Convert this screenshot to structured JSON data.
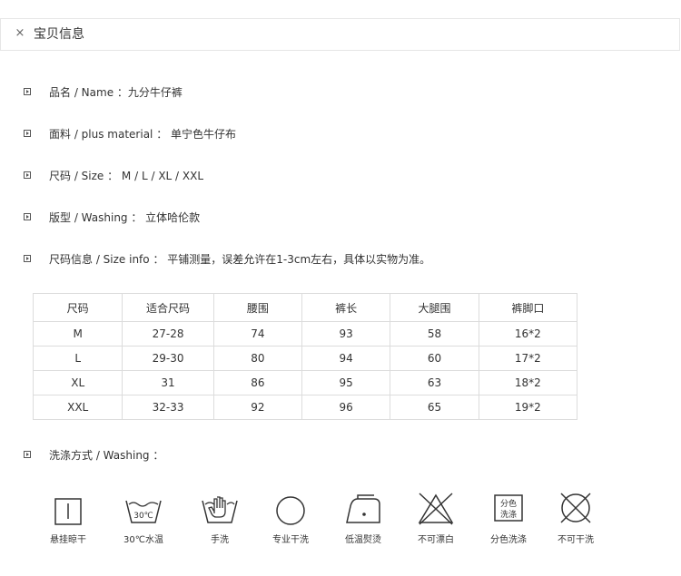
{
  "header": {
    "close_glyph": "×",
    "title": "宝贝信息"
  },
  "attributes": [
    {
      "label": "品名 / Name ：九分牛仔裤"
    },
    {
      "label": "面料 / plus material ： 单宁色牛仔布"
    },
    {
      "label": "尺码 / Size ： M / L / XL / XXL"
    },
    {
      "label": "版型 / Washing ： 立体哈伦款"
    },
    {
      "label": "尺码信息 / Size info ： 平铺测量，误差允许在1-3cm左右，具体以实物为准。"
    }
  ],
  "size_table": {
    "headers": [
      "尺码",
      "适合尺码",
      "腰围",
      "裤长",
      "大腿围",
      "裤脚口"
    ],
    "rows": [
      [
        "M",
        "27-28",
        "74",
        "93",
        "58",
        "16*2"
      ],
      [
        "L",
        "29-30",
        "80",
        "94",
        "60",
        "17*2"
      ],
      [
        "XL",
        "31",
        "86",
        "95",
        "63",
        "18*2"
      ],
      [
        "XXL",
        "32-33",
        "92",
        "96",
        "65",
        "19*2"
      ]
    ]
  },
  "washing": {
    "label": "洗涤方式 / Washing ：",
    "icons": [
      {
        "name": "hang-dry-icon",
        "caption": "悬挂晾干"
      },
      {
        "name": "wash-30c-icon",
        "caption": "30℃水温",
        "glyph": "30℃"
      },
      {
        "name": "hand-wash-icon",
        "caption": "手洗"
      },
      {
        "name": "professional-dry-clean-icon",
        "caption": "专业干洗"
      },
      {
        "name": "low-temp-iron-icon",
        "caption": "低温熨烫"
      },
      {
        "name": "no-bleach-icon",
        "caption": "不可漂白"
      },
      {
        "name": "separate-wash-icon",
        "caption": "分色洗涤",
        "glyph_top": "分色",
        "glyph_bottom": "洗涤"
      },
      {
        "name": "no-tumble-dry-icon",
        "caption": "不可干洗"
      }
    ]
  }
}
